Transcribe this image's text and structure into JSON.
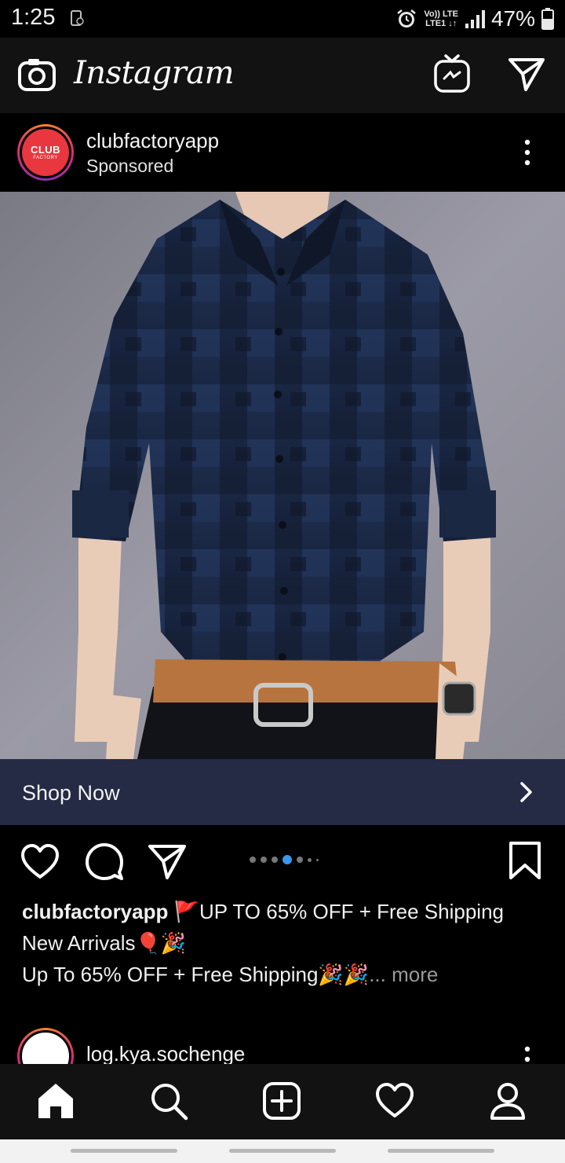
{
  "status_bar": {
    "time": "1:25",
    "network_top": "Vo)) LTE",
    "network_bottom": "LTE1 ↓↑",
    "battery": "47%"
  },
  "app_bar": {
    "logo": "Instagram",
    "icons": [
      "camera-icon",
      "igtv-icon",
      "direct-message-icon"
    ]
  },
  "post": {
    "username": "clubfactoryapp",
    "subtitle": "Sponsored",
    "avatar_line1": "CLUB",
    "avatar_line2": "FACTORY",
    "cta_label": "Shop Now",
    "carousel": {
      "count": 6,
      "active_index": 3
    },
    "caption": {
      "user": "clubfactoryapp",
      "line1": "🚩UP TO 65% OFF + Free Shipping",
      "line2": "New Arrivals🎈🎉",
      "line3": "Up To 65% OFF + Free Shipping🎉🎉",
      "more": "... more"
    },
    "colors": {
      "cta_background": "#252a45",
      "active_dot": "#3897f0",
      "brand_red": "#e8373e"
    }
  },
  "next_post": {
    "username": "log.kya.sochenge"
  },
  "bottom_nav": {
    "items": [
      "home-icon",
      "search-icon",
      "new-post-icon",
      "activity-icon",
      "profile-icon"
    ]
  }
}
